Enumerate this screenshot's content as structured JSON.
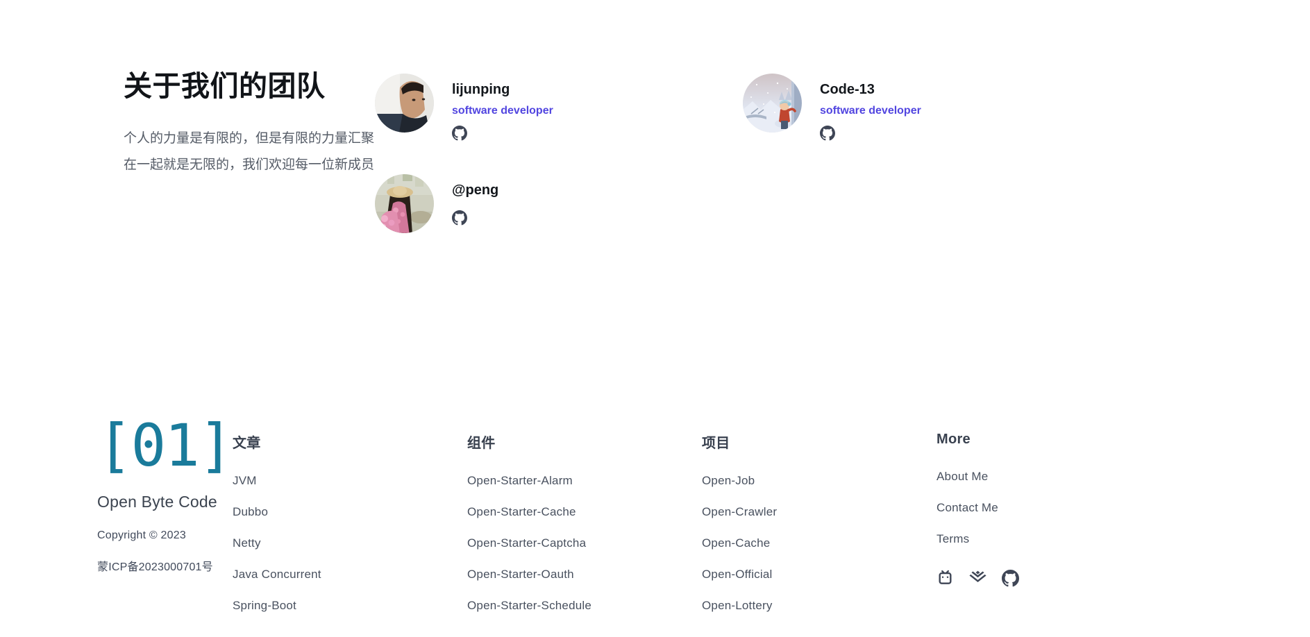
{
  "team": {
    "title": "关于我们的团队",
    "description": "个人的力量是有限的，但是有限的力量汇聚在一起就是无限的，我们欢迎每一位新成员",
    "members": [
      {
        "name": "lijunping",
        "role": "software developer",
        "avatar": "photo-portrait-man",
        "social_icon": "github-icon"
      },
      {
        "name": "Code-13",
        "role": "software developer",
        "avatar": "illustration-winter-snow",
        "social_icon": "github-icon"
      },
      {
        "name": "@peng",
        "role": "",
        "avatar": "photo-portrait-woman-flowers",
        "social_icon": "github-icon"
      }
    ]
  },
  "footer": {
    "logo_mark": "[01]",
    "brand_name": "Open Byte Code",
    "copyright": "Copyright © 2023",
    "icp": "蒙ICP备2023000701号",
    "columns": [
      {
        "title": "文章",
        "links": [
          "JVM",
          "Dubbo",
          "Netty",
          "Java Concurrent",
          "Spring-Boot"
        ]
      },
      {
        "title": "组件",
        "links": [
          "Open-Starter-Alarm",
          "Open-Starter-Cache",
          "Open-Starter-Captcha",
          "Open-Starter-Oauth",
          "Open-Starter-Schedule"
        ]
      },
      {
        "title": "项目",
        "links": [
          "Open-Job",
          "Open-Crawler",
          "Open-Cache",
          "Open-Official",
          "Open-Lottery"
        ]
      },
      {
        "title": "More",
        "links": [
          "About Me",
          "Contact Me",
          "Terms"
        ]
      }
    ],
    "social": [
      {
        "name": "bilibili-icon"
      },
      {
        "name": "juejin-icon"
      },
      {
        "name": "github-icon"
      }
    ]
  },
  "colors": {
    "accent_teal": "#1a7b9b",
    "role_purple": "#5145e0",
    "text_dark": "#13171c",
    "text_muted": "#49515f",
    "background": "#ffffff"
  }
}
